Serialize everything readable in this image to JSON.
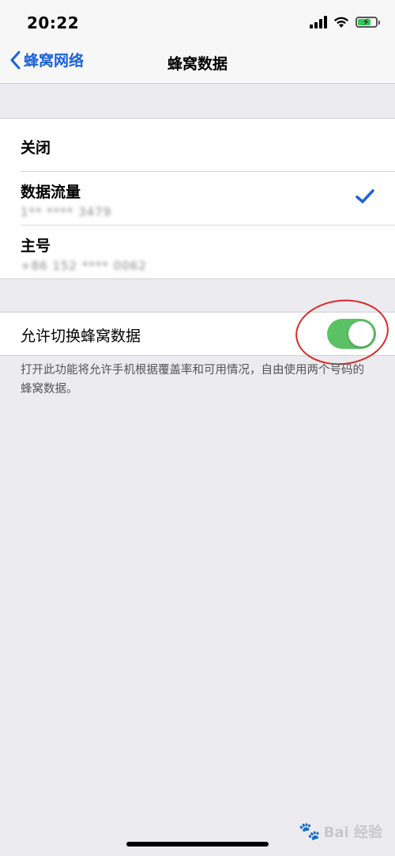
{
  "status_bar": {
    "time": "20:22"
  },
  "nav": {
    "back_label": "蜂窝网络",
    "title": "蜂窝数据"
  },
  "lines": [
    {
      "title": "关闭"
    },
    {
      "title": "数据流量",
      "detail": "1** **** 3479",
      "selected": true
    },
    {
      "title": "主号",
      "detail": "+86 152 **** 0062"
    }
  ],
  "switch_setting": {
    "label": "允许切换蜂窝数据",
    "enabled": true,
    "footnote": "打开此功能将允许手机根据覆盖率和可用情况，自由使用两个号码的蜂窝数据。"
  },
  "watermark": {
    "text": "Bai 经验"
  },
  "colors": {
    "accent": "#1c62d6",
    "toggle_on": "#5ac264",
    "annotation": "#d62b2b",
    "background": "#ebebf0"
  }
}
